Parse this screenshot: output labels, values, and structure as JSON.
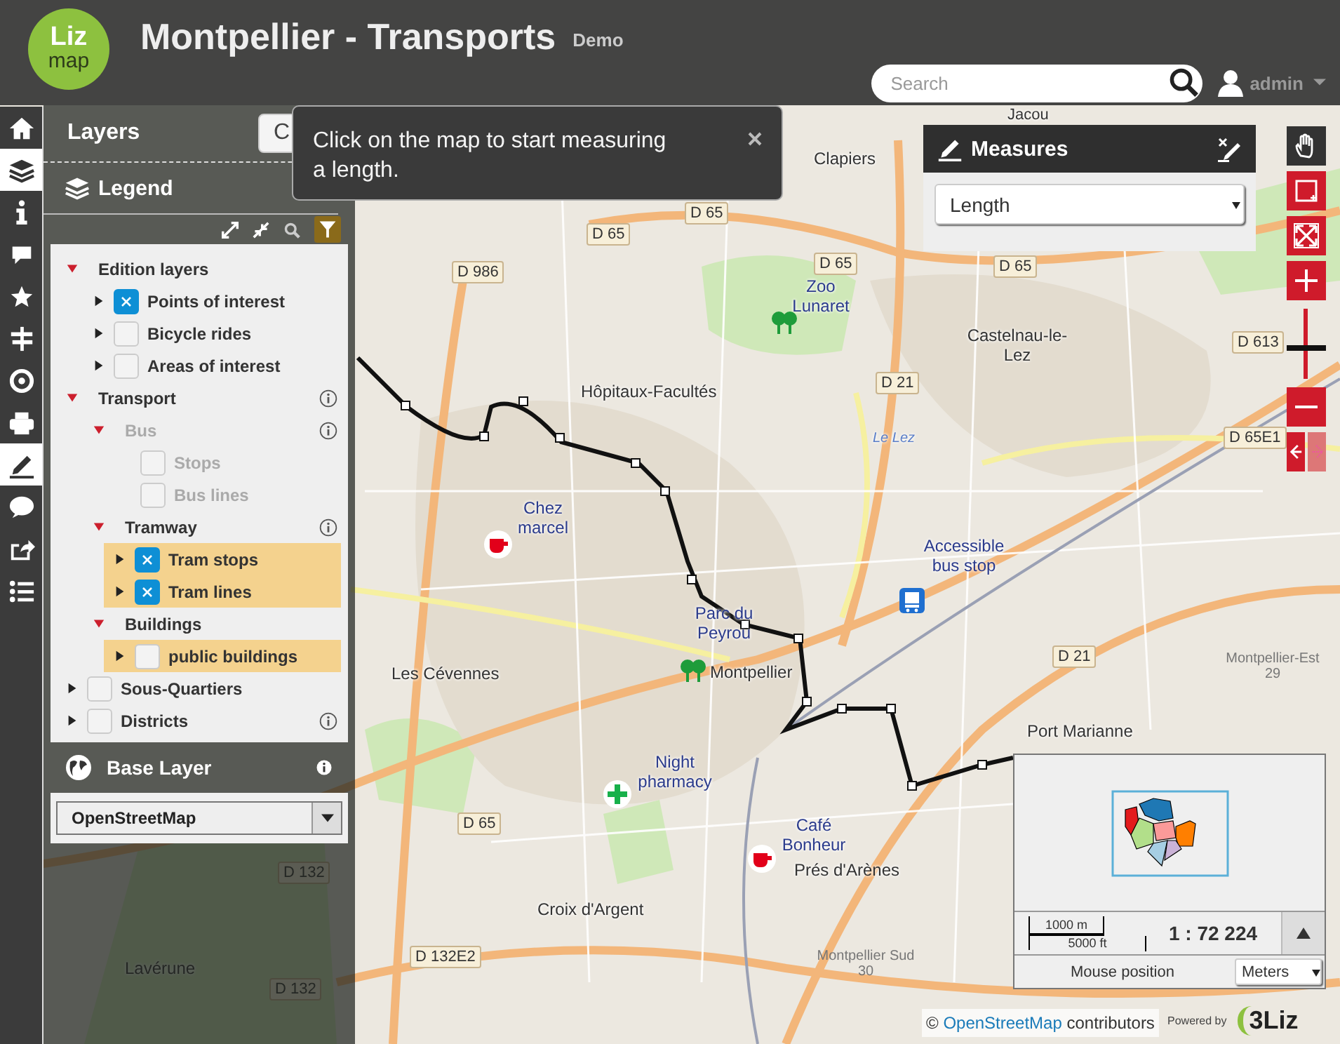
{
  "header": {
    "logo_top": "Liz",
    "logo_bottom": "map",
    "title": "Montpellier - Transports",
    "badge": "Demo",
    "search": {
      "placeholder": "Search"
    },
    "user": "admin"
  },
  "nav": [
    {
      "selected": false
    },
    {
      "selected": true
    },
    {
      "selected": false
    },
    {
      "selected": false
    },
    {
      "selected": false
    },
    {
      "selected": false
    },
    {
      "selected": false
    },
    {
      "selected": false
    },
    {
      "selected": true
    },
    {
      "selected": false
    },
    {
      "selected": false
    },
    {
      "selected": false
    }
  ],
  "layers_panel": {
    "title": "Layers",
    "button": "C",
    "legend_title": "Legend",
    "tree": [
      {
        "label": "Edition layers",
        "kind": "group",
        "expanded": true,
        "disabled": false,
        "selected": false,
        "info": false,
        "children": [
          {
            "label": "Points of interest",
            "kind": "layer",
            "expanded": false,
            "checked": true,
            "disabled": false,
            "selected": false,
            "info": false
          },
          {
            "label": "Bicycle rides",
            "kind": "layer",
            "expanded": false,
            "checked": false,
            "disabled": false,
            "selected": false,
            "info": false
          },
          {
            "label": "Areas of interest",
            "kind": "layer",
            "expanded": false,
            "checked": false,
            "disabled": false,
            "selected": false,
            "info": false
          }
        ]
      },
      {
        "label": "Transport",
        "kind": "group",
        "expanded": true,
        "disabled": false,
        "selected": false,
        "info": true,
        "children": [
          {
            "label": "Bus",
            "kind": "group",
            "expanded": true,
            "disabled": true,
            "selected": false,
            "info": true,
            "children": [
              {
                "label": "Stops",
                "kind": "item",
                "checked": false,
                "disabled": true,
                "selected": false,
                "info": false
              },
              {
                "label": "Bus lines",
                "kind": "item",
                "checked": false,
                "disabled": true,
                "selected": false,
                "info": false
              }
            ]
          },
          {
            "label": "Tramway",
            "kind": "group",
            "expanded": true,
            "disabled": false,
            "selected": false,
            "info": true,
            "children": [
              {
                "label": "Tram stops",
                "kind": "layer",
                "expanded": false,
                "checked": true,
                "disabled": false,
                "selected": true,
                "info": false
              },
              {
                "label": "Tram lines",
                "kind": "layer",
                "expanded": false,
                "checked": true,
                "disabled": false,
                "selected": true,
                "info": false
              }
            ]
          },
          {
            "label": "Buildings",
            "kind": "group",
            "expanded": true,
            "disabled": false,
            "selected": false,
            "info": false,
            "children": [
              {
                "label": "public buildings",
                "kind": "layer",
                "expanded": false,
                "checked": false,
                "disabled": false,
                "selected": true,
                "info": false
              }
            ]
          }
        ]
      },
      {
        "label": "Sous-Quartiers",
        "kind": "layer",
        "expanded": false,
        "checked": false,
        "disabled": false,
        "selected": false,
        "info": false
      },
      {
        "label": "Districts",
        "kind": "layer",
        "expanded": false,
        "checked": false,
        "disabled": false,
        "selected": false,
        "info": true
      }
    ],
    "base_layer_title": "Base Layer",
    "base_layer": "OpenStreetMap"
  },
  "tooltip": {
    "text": "Click on the map to start measuring a length."
  },
  "measures": {
    "title": "Measures",
    "mode": "Length"
  },
  "map_tools": [
    {
      "selected": true
    },
    {
      "selected": false
    },
    {
      "selected": false
    },
    {
      "selected": false
    }
  ],
  "zoom": {
    "level": 0.4
  },
  "map": {
    "labels": [
      {
        "text": "Jacou",
        "kind": "place"
      },
      {
        "text": "Clapiers",
        "kind": "place"
      },
      {
        "text": "D 65",
        "kind": "road"
      },
      {
        "text": "D 65",
        "kind": "road"
      },
      {
        "text": "D 986",
        "kind": "road"
      },
      {
        "text": "D 65",
        "kind": "road"
      },
      {
        "text": "D 65",
        "kind": "road"
      },
      {
        "text": "Zoo Lunaret",
        "kind": "poi"
      },
      {
        "text": "Castelnau-le-Lez",
        "kind": "place"
      },
      {
        "text": "D 613",
        "kind": "road"
      },
      {
        "text": "Hôpitaux-Facultés",
        "kind": "place"
      },
      {
        "text": "D 21",
        "kind": "road"
      },
      {
        "text": "D 65E1",
        "kind": "road"
      },
      {
        "text": "Le Lez",
        "kind": "water"
      },
      {
        "text": "Chez marcel",
        "kind": "poi"
      },
      {
        "text": "Accessible bus stop",
        "kind": "poi"
      },
      {
        "text": "Parc du Peyrou",
        "kind": "poi"
      },
      {
        "text": "D 21",
        "kind": "road"
      },
      {
        "text": "Les Cévennes",
        "kind": "place"
      },
      {
        "text": "Montpellier",
        "kind": "place"
      },
      {
        "text": "Montpellier-Est 29",
        "kind": "exit"
      },
      {
        "text": "Port Marianne",
        "kind": "place"
      },
      {
        "text": "Night pharmacy",
        "kind": "poi"
      },
      {
        "text": "D 65",
        "kind": "road"
      },
      {
        "text": "Café Bonheur",
        "kind": "poi"
      },
      {
        "text": "D 132",
        "kind": "road"
      },
      {
        "text": "Prés d'Arènes",
        "kind": "place"
      },
      {
        "text": "Croix d'Argent",
        "kind": "place"
      },
      {
        "text": "Lavérune",
        "kind": "place"
      },
      {
        "text": "D 132E2",
        "kind": "road"
      },
      {
        "text": "Montpellier Sud 30",
        "kind": "exit"
      },
      {
        "text": "D 132",
        "kind": "road"
      }
    ],
    "markers": [
      {
        "kind": "park"
      },
      {
        "kind": "cafe"
      },
      {
        "kind": "bus"
      },
      {
        "kind": "park"
      },
      {
        "kind": "pharmacy"
      },
      {
        "kind": "cafe"
      }
    ]
  },
  "overview": {
    "scale_metric": "1000 m",
    "scale_imperial": "5000 ft",
    "scale": "1 : 72 224",
    "mouse_position": "Mouse position",
    "units": "Meters"
  },
  "attribution": {
    "prefix": "©",
    "link": "OpenStreetMap",
    "suffix": "contributors"
  },
  "powered_by": {
    "text": "Powered by",
    "logo": "3Liz"
  }
}
